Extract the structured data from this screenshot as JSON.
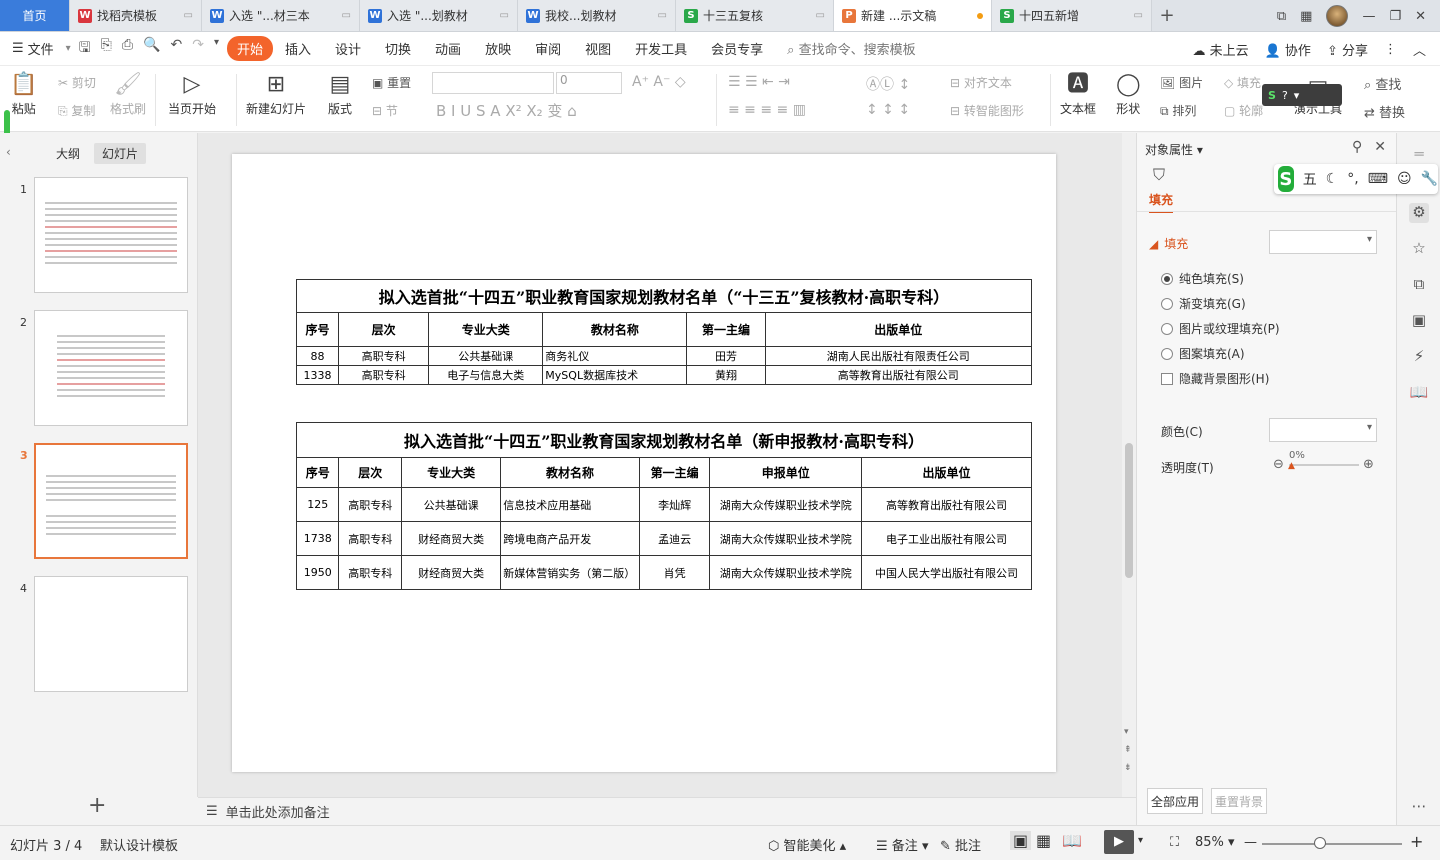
{
  "tabs": [
    {
      "label": "首页",
      "icon": "",
      "type": "home"
    },
    {
      "label": "找稻壳模板",
      "icon": "W",
      "color": "#d9363e"
    },
    {
      "label": "入选 \"...材三本",
      "icon": "W",
      "color": "#2f72d8"
    },
    {
      "label": "入选 \"...划教材",
      "icon": "W",
      "color": "#2f72d8"
    },
    {
      "label": "我校...划教材",
      "icon": "W",
      "color": "#2f72d8"
    },
    {
      "label": "十三五复核",
      "icon": "S",
      "color": "#2aa84a"
    },
    {
      "label": "新建 ...示文稿",
      "icon": "P",
      "color": "#e8763b",
      "active": true
    },
    {
      "label": "十四五新增",
      "icon": "S",
      "color": "#2aa84a"
    }
  ],
  "menu": {
    "file": "文件",
    "items": [
      "开始",
      "插入",
      "设计",
      "切换",
      "动画",
      "放映",
      "审阅",
      "视图",
      "开发工具",
      "会员专享"
    ],
    "search": "查找命令、搜索模板",
    "right": [
      "未上云",
      "协作",
      "分享"
    ]
  },
  "ribbon": {
    "paste": "粘贴",
    "cut": "剪切",
    "copy": "复制",
    "format_painter": "格式刷",
    "from_start": "当页开始",
    "new_slide": "新建幻灯片",
    "layout": "版式",
    "reset": "重置",
    "section": "节",
    "font_size": "0",
    "align_text": "对齐文本",
    "smart_graphic": "转智能图形",
    "textbox": "文本框",
    "shape": "形状",
    "picture": "图片",
    "arrange": "排列",
    "fill": "填充",
    "outline": "轮廓",
    "presentation_tools": "演示工具",
    "find": "查找",
    "replace": "替换"
  },
  "left_pane": {
    "tab_outline": "大纲",
    "tab_slides": "幻灯片",
    "slide_numbers": [
      "1",
      "2",
      "3",
      "4"
    ],
    "selected": "3"
  },
  "table1": {
    "title": "拟入选首批“十四五”职业教育国家规划教材名单（“十三五”复核教材·高职专科）",
    "headers": [
      "序号",
      "层次",
      "专业大类",
      "教材名称",
      "第一主编",
      "出版单位"
    ],
    "rows": [
      [
        "88",
        "高职专科",
        "公共基础课",
        "商务礼仪",
        "田芳",
        "湖南人民出版社有限责任公司"
      ],
      [
        "1338",
        "高职专科",
        "电子与信息大类",
        "MySQL数据库技术",
        "黄翔",
        "高等教育出版社有限公司"
      ]
    ]
  },
  "table2": {
    "title": "拟入选首批“十四五”职业教育国家规划教材名单（新申报教材·高职专科）",
    "headers": [
      "序号",
      "层次",
      "专业大类",
      "教材名称",
      "第一主编",
      "申报单位",
      "出版单位"
    ],
    "rows": [
      [
        "125",
        "高职专科",
        "公共基础课",
        "信息技术应用基础",
        "李灿辉",
        "湖南大众传媒职业技术学院",
        "高等教育出版社有限公司"
      ],
      [
        "1738",
        "高职专科",
        "财经商贸大类",
        "跨境电商产品开发",
        "孟迪云",
        "湖南大众传媒职业技术学院",
        "电子工业出版社有限公司"
      ],
      [
        "1950",
        "高职专科",
        "财经商贸大类",
        "新媒体营销实务（第二版）",
        "肖凭",
        "湖南大众传媒职业技术学院",
        "中国人民大学出版社有限公司"
      ]
    ]
  },
  "notes_placeholder": "单击此处添加备注",
  "right_pane": {
    "title": "对象属性",
    "tab_fill": "填充",
    "section_fill": "填充",
    "options": [
      "纯色填充(S)",
      "渐变填充(G)",
      "图片或纹理填充(P)",
      "图案填充(A)"
    ],
    "hide_bg": "隐藏背景图形(H)",
    "color_label": "颜色(C)",
    "transparency_label": "透明度(T)",
    "transparency_value": "0%",
    "apply_all": "全部应用",
    "reset_bg": "重置背景"
  },
  "sogou": {
    "mode": "五"
  },
  "status": {
    "slide_info": "幻灯片 3 / 4",
    "theme": "默认设计模板",
    "beautify": "智能美化",
    "notes": "备注",
    "comments": "批注",
    "zoom": "85%"
  }
}
